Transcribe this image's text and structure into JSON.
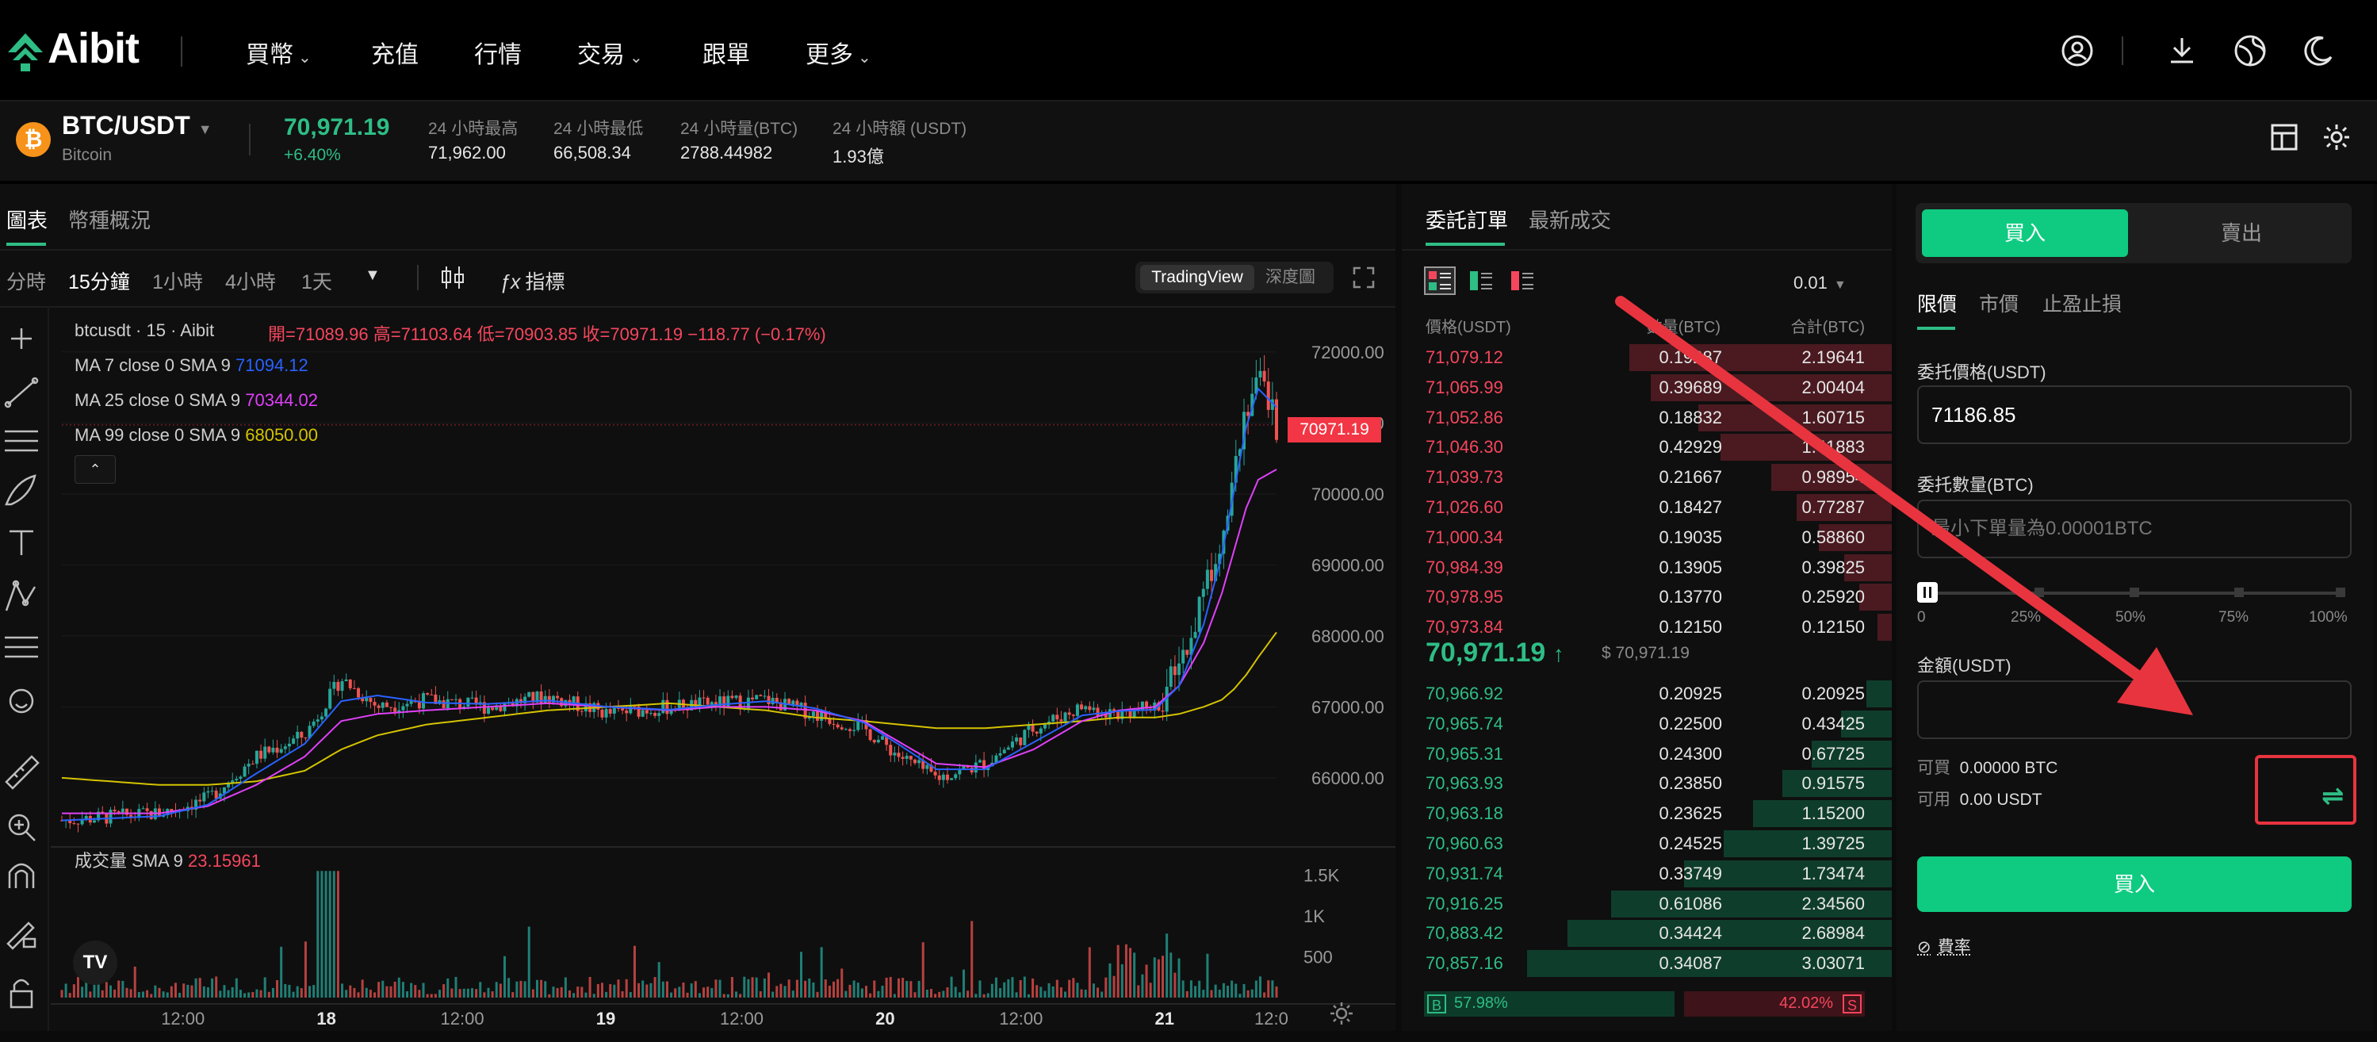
{
  "nav": {
    "logo": "Aibit",
    "items": [
      {
        "label": "買幣",
        "has_dropdown": true
      },
      {
        "label": "充值",
        "has_dropdown": false
      },
      {
        "label": "行情",
        "has_dropdown": false
      },
      {
        "label": "交易",
        "has_dropdown": true
      },
      {
        "label": "跟單",
        "has_dropdown": false
      },
      {
        "label": "更多",
        "has_dropdown": true
      }
    ],
    "icons": [
      "user-icon",
      "download-icon",
      "globe-icon",
      "moon-icon"
    ]
  },
  "ticker": {
    "pair": "BTC/USDT",
    "coin_name": "Bitcoin",
    "coin_symbol": "₿",
    "last_price": "70,971.19",
    "change": "+6.40%",
    "stats": [
      {
        "label": "24 小時最高",
        "value": "71,962.00"
      },
      {
        "label": "24 小時最低",
        "value": "66,508.34"
      },
      {
        "label": "24 小時量(BTC)",
        "value": "2788.44982"
      },
      {
        "label": "24 小時額 (USDT)",
        "value": "1.93億"
      }
    ]
  },
  "chart_panel": {
    "tabs": [
      "圖表",
      "幣種概況"
    ],
    "active_tab": "圖表",
    "intervals": [
      "分時",
      "15分鐘",
      "1小時",
      "4小時",
      "1天"
    ],
    "active_interval": "15分鐘",
    "indicator_label": "指標",
    "view_toggle": [
      "TradingView",
      "深度圖"
    ],
    "active_view": "TradingView",
    "header": {
      "symbol": "btcusdt · 15 · Aibit",
      "ohlc": "開=71089.96 高=71103.64 低=70903.85 收=70971.19 −118.77 (−0.17%)"
    },
    "ma_legend": [
      {
        "label": "MA 7 close 0 SMA 9",
        "value": "71094.12",
        "color": "#2962ff"
      },
      {
        "label": "MA 25 close 0 SMA 9",
        "value": "70344.02",
        "color": "#e040fb"
      },
      {
        "label": "MA 99 close 0 SMA 9",
        "value": "68050.00",
        "color": "#d4c300"
      }
    ],
    "volume_legend": {
      "label": "成交量 SMA 9",
      "value": "23.15961"
    },
    "current_price_tag": "70971.19"
  },
  "chart_data": {
    "type": "candlestick",
    "title": "btcusdt · 15 · Aibit",
    "y_ticks": [
      "72000.00",
      "71000.00",
      "70000.00",
      "69000.00",
      "68000.00",
      "67000.00",
      "66000.00"
    ],
    "y_values": [
      72000,
      71000,
      70000,
      69000,
      68000,
      67000,
      66000
    ],
    "ylim": [
      65250,
      72400
    ],
    "volume_ticks": [
      "1.5K",
      "1K",
      "500"
    ],
    "volume_tick_values": [
      1500,
      1000,
      500
    ],
    "volume_max": 1650,
    "x_ticks": [
      "12:00",
      "18",
      "12:00",
      "19",
      "12:00",
      "20",
      "12:00",
      "21",
      "12:0"
    ],
    "x_tick_fracs": [
      0.1,
      0.215,
      0.33,
      0.445,
      0.56,
      0.675,
      0.79,
      0.905,
      1.0
    ],
    "price_path_fracs": [
      0,
      0.08,
      0.12,
      0.16,
      0.2,
      0.23,
      0.26,
      0.3,
      0.35,
      0.4,
      0.45,
      0.5,
      0.54,
      0.58,
      0.62,
      0.66,
      0.69,
      0.72,
      0.76,
      0.8,
      0.84,
      0.87,
      0.9,
      0.92,
      0.94,
      0.955,
      0.965,
      0.975,
      0.985,
      1.0
    ],
    "price_path": [
      65400,
      65500,
      65700,
      66300,
      66600,
      67400,
      67000,
      67100,
      67000,
      67150,
      66900,
      67000,
      67050,
      67100,
      66900,
      66700,
      66300,
      66000,
      66200,
      66700,
      67000,
      66900,
      67000,
      67500,
      68600,
      69500,
      70400,
      71300,
      71600,
      70971
    ],
    "ma99_path": [
      66000,
      65900,
      65900,
      65950,
      66100,
      66400,
      66600,
      66750,
      66850,
      66950,
      67000,
      67050,
      67000,
      66950,
      66850,
      66800,
      66750,
      66700,
      66700,
      66750,
      66800,
      66850,
      66850,
      66900,
      67000,
      67100,
      67250,
      67450,
      67700,
      68050
    ],
    "ma25_path": [
      65500,
      65500,
      65600,
      65900,
      66300,
      66800,
      66900,
      66950,
      67000,
      67050,
      67000,
      66950,
      67000,
      67000,
      66950,
      66800,
      66500,
      66200,
      66150,
      66400,
      66800,
      66950,
      67000,
      67300,
      67900,
      68600,
      69200,
      69800,
      70200,
      70344
    ]
  },
  "order_book": {
    "tabs": [
      "委託訂單",
      "最新成交"
    ],
    "active_tab": "委託訂單",
    "precision": "0.01",
    "headers": [
      "價格(USDT)",
      "數量(BTC)",
      "合計(BTC)"
    ],
    "asks": [
      {
        "price": "71,079.12",
        "qty": "0.19287",
        "total": "2.19641",
        "depth": 0.72
      },
      {
        "price": "71,065.99",
        "qty": "0.39689",
        "total": "2.00404",
        "depth": 0.66
      },
      {
        "price": "71,052.86",
        "qty": "0.18832",
        "total": "1.60715",
        "depth": 0.53
      },
      {
        "price": "71,046.30",
        "qty": "0.42929",
        "total": "1.41883",
        "depth": 0.47
      },
      {
        "price": "71,039.73",
        "qty": "0.21667",
        "total": "0.98954",
        "depth": 0.33
      },
      {
        "price": "71,026.60",
        "qty": "0.18427",
        "total": "0.77287",
        "depth": 0.26
      },
      {
        "price": "71,000.34",
        "qty": "0.19035",
        "total": "0.58860",
        "depth": 0.2
      },
      {
        "price": "70,984.39",
        "qty": "0.13905",
        "total": "0.39825",
        "depth": 0.13
      },
      {
        "price": "70,978.95",
        "qty": "0.13770",
        "total": "0.25920",
        "depth": 0.09
      },
      {
        "price": "70,973.84",
        "qty": "0.12150",
        "total": "0.12150",
        "depth": 0.04
      }
    ],
    "mid_price": "70,971.19",
    "mid_arrow": "↑",
    "mid_usd": "$ 70,971.19",
    "bids": [
      {
        "price": "70,966.92",
        "qty": "0.20925",
        "total": "0.20925",
        "depth": 0.07
      },
      {
        "price": "70,965.74",
        "qty": "0.22500",
        "total": "0.43425",
        "depth": 0.14
      },
      {
        "price": "70,965.31",
        "qty": "0.24300",
        "total": "0.67725",
        "depth": 0.22
      },
      {
        "price": "70,963.93",
        "qty": "0.23850",
        "total": "0.91575",
        "depth": 0.3
      },
      {
        "price": "70,963.18",
        "qty": "0.23625",
        "total": "1.15200",
        "depth": 0.38
      },
      {
        "price": "70,960.63",
        "qty": "0.24525",
        "total": "1.39725",
        "depth": 0.46
      },
      {
        "price": "70,931.74",
        "qty": "0.33749",
        "total": "1.73474",
        "depth": 0.57
      },
      {
        "price": "70,916.25",
        "qty": "0.61086",
        "total": "2.34560",
        "depth": 0.77
      },
      {
        "price": "70,883.42",
        "qty": "0.34424",
        "total": "2.68984",
        "depth": 0.89
      },
      {
        "price": "70,857.16",
        "qty": "0.34087",
        "total": "3.03071",
        "depth": 1.0
      }
    ],
    "ratio": {
      "buy_label": "B",
      "buy": "57.98%",
      "sell": "42.02%",
      "sell_label": "S",
      "buy_fraction": 0.5798
    }
  },
  "trade": {
    "buy_tab": "買入",
    "sell_tab": "賣出",
    "order_types": [
      "限價",
      "市價",
      "止盈止損"
    ],
    "active_order_type": "限價",
    "price_label": "委托價格(USDT)",
    "price_value": "71186.85",
    "qty_label": "委托數量(BTC)",
    "qty_placeholder": "最小下單量為0.00001BTC",
    "slider_marks": [
      "0",
      "25%",
      "50%",
      "75%",
      "100%"
    ],
    "slider_value": 0,
    "amount_label": "金額(USDT)",
    "available_buy_label": "可買",
    "available_buy_value": "0.00000 BTC",
    "available_label": "可用",
    "available_value": "0.00 USDT",
    "transfer_icon": "⇌",
    "submit_label": "買入",
    "fee_label": "費率",
    "colors": {
      "buy": "#0ecb81",
      "sell": "#f6465d"
    }
  }
}
